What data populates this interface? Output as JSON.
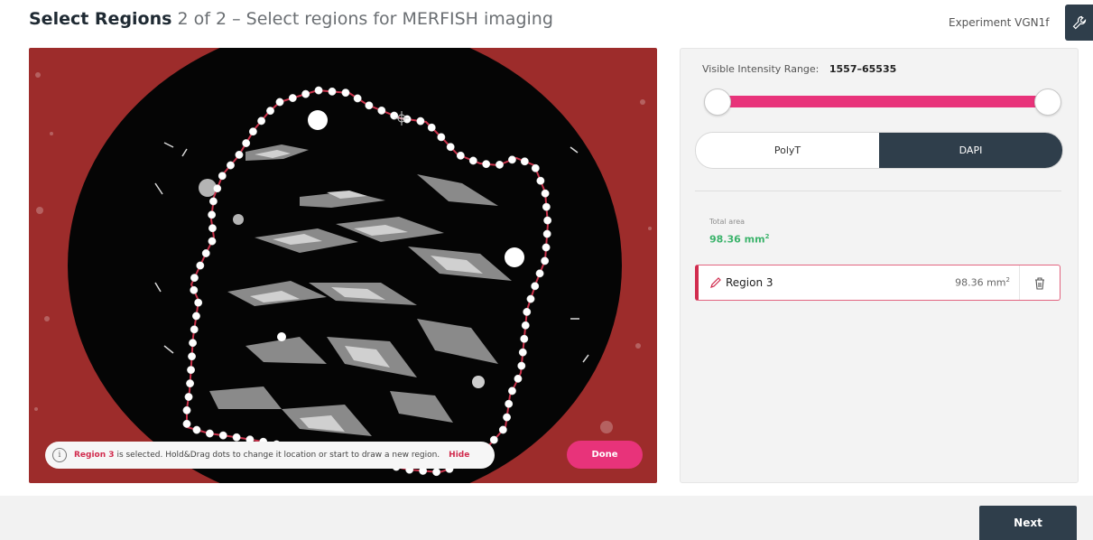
{
  "header": {
    "title_bold": "Select Regions",
    "title_rest": "2 of 2 – Select regions for MERFISH imaging",
    "experiment": "Experiment VGN1f",
    "tool_icon": "wrench-icon"
  },
  "viewer": {
    "info": {
      "region": "Region 3",
      "message": "is selected. Hold&Drag dots to change it location or start to draw a new region.",
      "hide": "Hide"
    },
    "done_label": "Done",
    "colors": {
      "background": "#9d2c2b",
      "outline": "#c9314a",
      "dot": "#ffffff"
    }
  },
  "side": {
    "range_label": "Visible Intensity Range:",
    "range_value": "1557–65535",
    "channels": [
      "PolyT",
      "DAPI"
    ],
    "selected_channel": "DAPI",
    "total_label": "Total area",
    "total_value": "98.36 mm",
    "total_unit_sup": "2",
    "region": {
      "name": "Region 3",
      "area": "98.36 mm",
      "area_sup": "2"
    }
  },
  "footer": {
    "next_label": "Next"
  },
  "colors": {
    "accent": "#e8337a",
    "dark": "#2f3e4b",
    "green": "#3bb36b"
  }
}
